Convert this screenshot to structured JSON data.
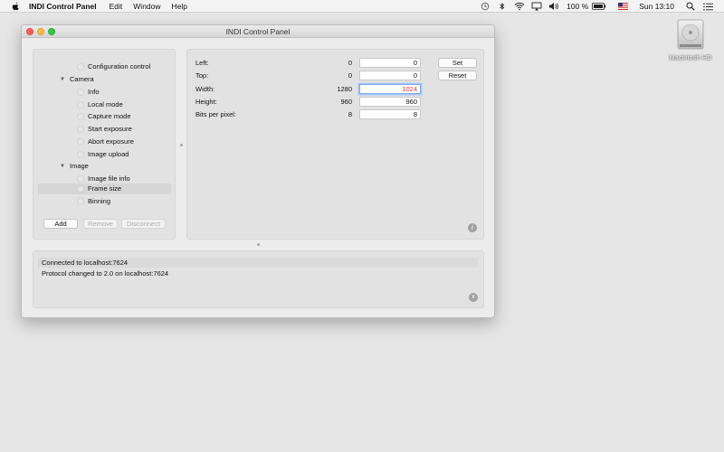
{
  "menubar": {
    "app_name": "INDI Control Panel",
    "menus": [
      "Edit",
      "Window",
      "Help"
    ],
    "battery_text": "100 %",
    "clock": "Sun 13:10"
  },
  "desktop": {
    "disk_label": "Macintosh HD"
  },
  "window": {
    "title": "INDI Control Panel"
  },
  "tree": {
    "items": [
      {
        "label": "Configuration control",
        "level": 2
      },
      {
        "label": "Camera",
        "level": 1
      },
      {
        "label": "Info",
        "level": 2
      },
      {
        "label": "Local mode",
        "level": 2
      },
      {
        "label": "Capture mode",
        "level": 2
      },
      {
        "label": "Start exposure",
        "level": 2
      },
      {
        "label": "Abort exposure",
        "level": 2
      },
      {
        "label": "Image upload",
        "level": 2
      },
      {
        "label": "Image",
        "level": 1
      },
      {
        "label": "Image file info",
        "level": 2
      },
      {
        "label": "Frame size",
        "level": 2,
        "selected": true
      },
      {
        "label": "Binning",
        "level": 2
      }
    ],
    "buttons": {
      "add": "Add",
      "remove": "Remove",
      "disconnect": "Disconnect"
    }
  },
  "properties": {
    "rows": [
      {
        "label": "Left:",
        "current": "0",
        "input": "0"
      },
      {
        "label": "Top:",
        "current": "0",
        "input": "0"
      },
      {
        "label": "Width:",
        "current": "1280",
        "input": "1024"
      },
      {
        "label": "Height:",
        "current": "960",
        "input": "960"
      },
      {
        "label": "Bits per pixel:",
        "current": "8",
        "input": "8"
      }
    ],
    "set_label": "Set",
    "reset_label": "Reset",
    "info_glyph": "i"
  },
  "log": {
    "lines": [
      "Connected to localhost:7624",
      "Protocol changed to 2.0 on localhost:7624"
    ],
    "clear_glyph": "x"
  }
}
